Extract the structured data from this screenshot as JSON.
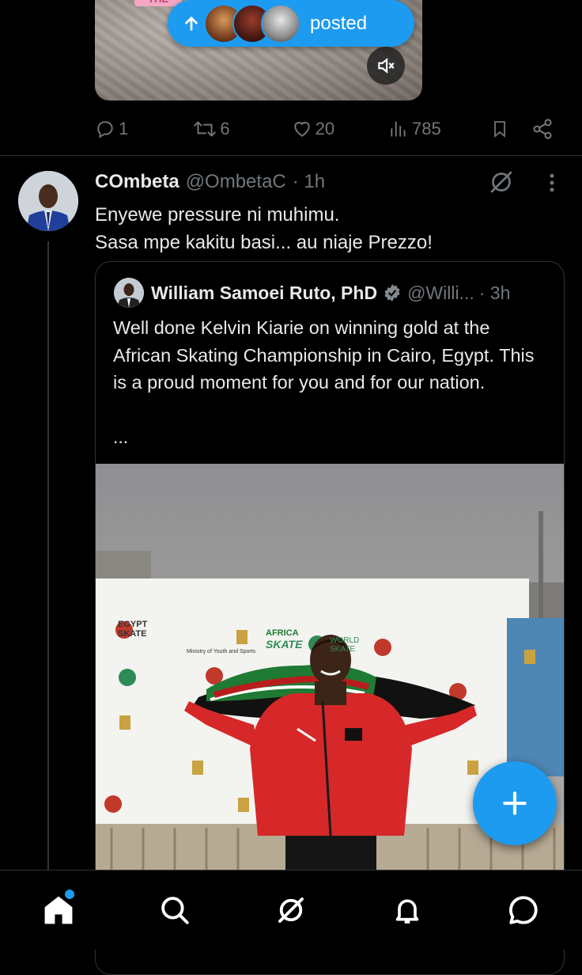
{
  "previous_post": {
    "media_tag": "THE",
    "actions": {
      "replies": "1",
      "reposts": "6",
      "likes": "20",
      "views": "785"
    }
  },
  "posted_pill": {
    "label": "posted"
  },
  "post": {
    "display_name": "COmbeta",
    "handle": "@OmbetaC",
    "time": "· 1h",
    "text_line1": "Enyewe pressure ni muhimu.",
    "text_line2": "Sasa mpe kakitu basi... au niaje Prezzo!",
    "quoted": {
      "display_name": "William Samoei Ruto, PhD",
      "handle": "@Willi...",
      "time": "· 3h",
      "text": "Well done Kelvin Kiarie on winning gold at the African Skating Championship in Cairo, Egypt. This is a proud moment for you and for our nation.",
      "ellipsis": "...",
      "photo_banner": {
        "brand1": "EGYPT",
        "brand1b": "SKATE",
        "africa": "AFRICA",
        "skate": "SKATE",
        "world": "WORLD",
        "skate2": "SKATE",
        "ministry": "Ministry of Youth and Sports"
      }
    }
  },
  "colors": {
    "accent": "#1d9bf0",
    "background": "#000000",
    "muted": "#71767b",
    "divider": "#2f3336"
  },
  "icons": {
    "reply": "reply-icon",
    "repost": "repost-icon",
    "like": "heart-icon",
    "views": "views-icon",
    "bookmark": "bookmark-icon",
    "share": "share-icon",
    "grok": "grok-icon",
    "more": "more-icon",
    "fab": "plus-icon",
    "nav": [
      "home-icon",
      "search-icon",
      "grok-icon",
      "bell-icon",
      "messages-icon"
    ]
  }
}
